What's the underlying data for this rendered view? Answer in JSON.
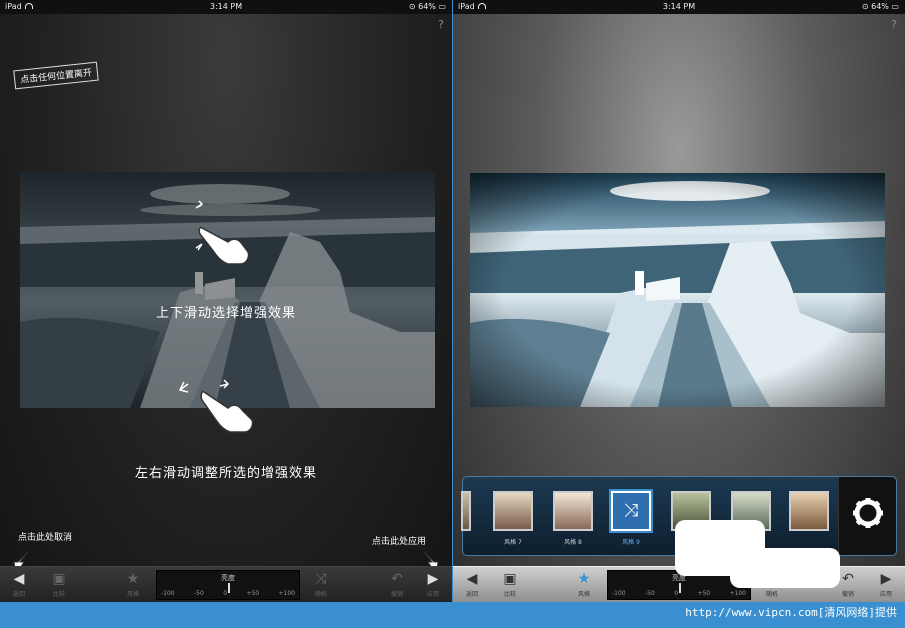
{
  "status": {
    "carrier": "iPad",
    "time": "3:14 PM",
    "battery": "64%"
  },
  "help": "?",
  "left": {
    "tag": "点击任何位置离开",
    "hint1": "上下滑动选择增强效果",
    "hint2": "左右滑动调整所选的增强效果",
    "note_cancel": "点击此处取消",
    "note_apply": "点击此处应用",
    "toolbar": {
      "back": "返回",
      "compare": "比较",
      "style": "风格",
      "slider_title": "亮度",
      "ticks": [
        "-100",
        "-50",
        "0",
        "+50",
        "+100"
      ],
      "random": "随机",
      "undo": "撤销",
      "apply": "应用"
    }
  },
  "right": {
    "styles": [
      {
        "label": "风格 7",
        "icon": "film-thumb"
      },
      {
        "label": "风格 8",
        "icon": "film-thumb"
      },
      {
        "label": "风格 9",
        "icon": "shuffle-icon",
        "selected": true
      },
      {
        "label": "",
        "icon": "film-thumb"
      },
      {
        "label": "",
        "icon": "film-thumb"
      },
      {
        "label": "",
        "icon": "film-thumb"
      }
    ],
    "toolbar": {
      "back": "返回",
      "compare": "比较",
      "style": "风格",
      "slider_title": "亮度",
      "ticks": [
        "-100",
        "-50",
        "0",
        "+50",
        "+100"
      ],
      "random": "随机",
      "undo": "撤销",
      "apply": "应用"
    }
  },
  "watermark": "http://www.vipcn.com[清风网络]提供",
  "colors": {
    "accent": "#3a8fd0"
  }
}
